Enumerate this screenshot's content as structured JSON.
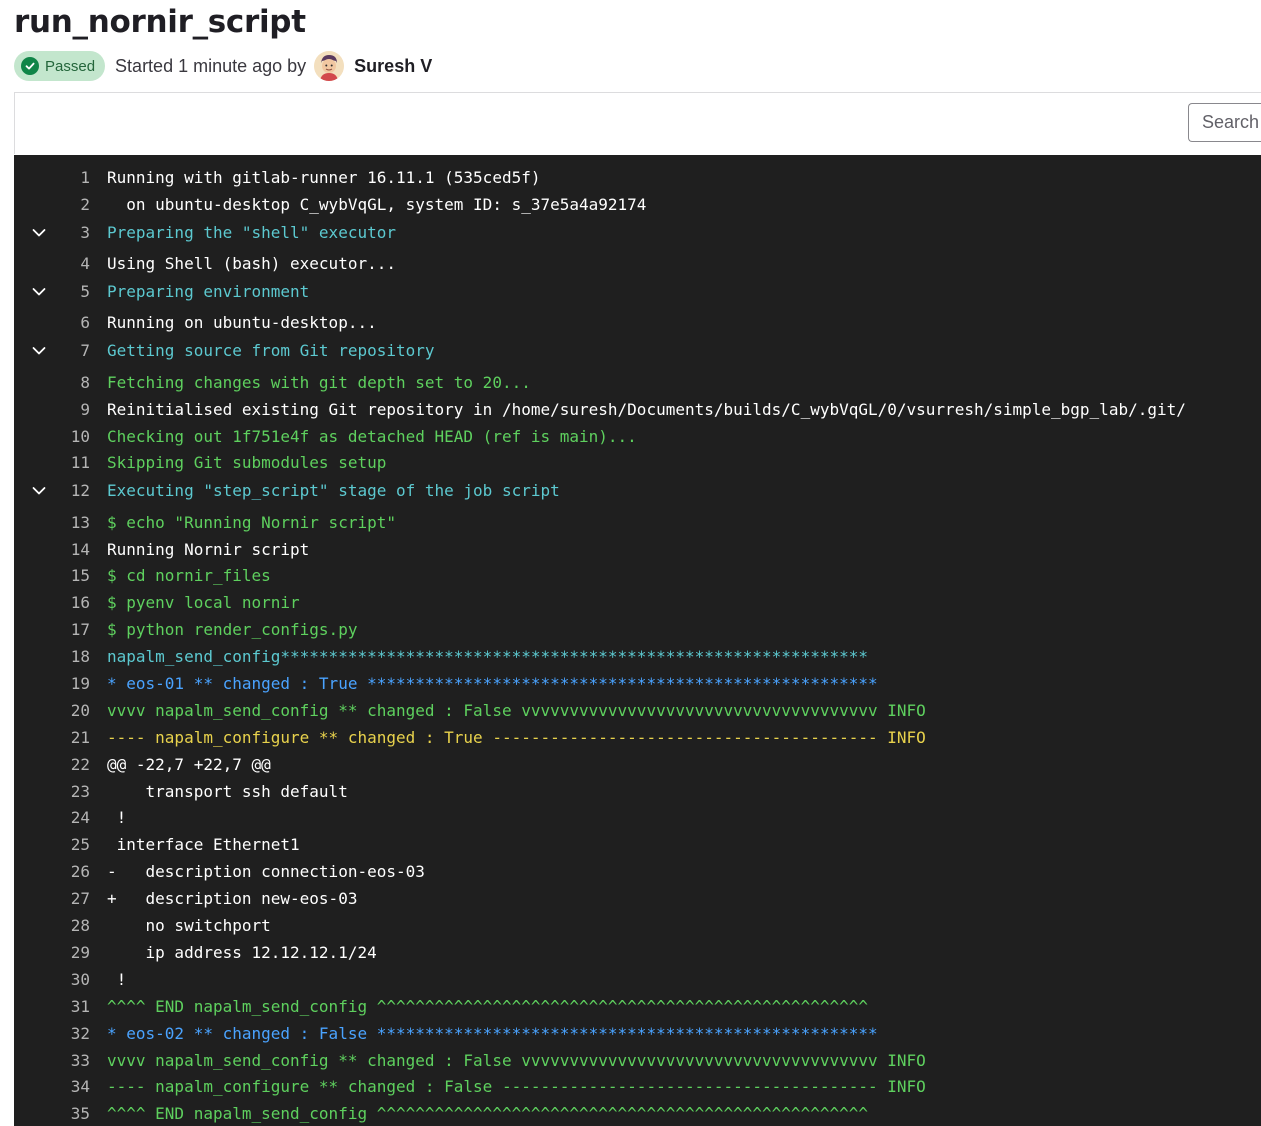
{
  "job": {
    "title": "run_nornir_script",
    "status": "Passed",
    "started": "Started 1 minute ago by",
    "user": "Suresh V"
  },
  "search": {
    "placeholder": "Search"
  },
  "colors": {
    "passed_bg": "#c3e6cd",
    "passed_text": "#24663b",
    "log_bg": "#1f1f1f"
  },
  "log": [
    {
      "num": "1",
      "text": "Running with gitlab-runner 16.11.1 (535ced5f)",
      "color": "white"
    },
    {
      "num": "2",
      "text": "  on ubuntu-desktop C_wybVqGL, system ID: s_37e5a4a92174",
      "color": "white"
    },
    {
      "num": "3",
      "text": "Preparing the \"shell\" executor",
      "color": "cyan",
      "section": true
    },
    {
      "num": "4",
      "text": "Using Shell (bash) executor...",
      "color": "white"
    },
    {
      "num": "5",
      "text": "Preparing environment",
      "color": "cyan",
      "section": true
    },
    {
      "num": "6",
      "text": "Running on ubuntu-desktop...",
      "color": "white"
    },
    {
      "num": "7",
      "text": "Getting source from Git repository",
      "color": "cyan",
      "section": true
    },
    {
      "num": "8",
      "text": "Fetching changes with git depth set to 20...",
      "color": "green"
    },
    {
      "num": "9",
      "text": "Reinitialised existing Git repository in /home/suresh/Documents/builds/C_wybVqGL/0/vsurresh/simple_bgp_lab/.git/",
      "color": "white"
    },
    {
      "num": "10",
      "text": "Checking out 1f751e4f as detached HEAD (ref is main)...",
      "color": "green"
    },
    {
      "num": "11",
      "text": "Skipping Git submodules setup",
      "color": "green"
    },
    {
      "num": "12",
      "text": "Executing \"step_script\" stage of the job script",
      "color": "cyan",
      "section": true
    },
    {
      "num": "13",
      "text": "$ echo \"Running Nornir script\"",
      "color": "green"
    },
    {
      "num": "14",
      "text": "Running Nornir script",
      "color": "white"
    },
    {
      "num": "15",
      "text": "$ cd nornir_files",
      "color": "green"
    },
    {
      "num": "16",
      "text": "$ pyenv local nornir",
      "color": "green"
    },
    {
      "num": "17",
      "text": "$ python render_configs.py",
      "color": "green"
    },
    {
      "num": "18",
      "text": "napalm_send_config*************************************************************",
      "color": "cyan"
    },
    {
      "num": "19",
      "text": "* eos-01 ** changed : True *****************************************************",
      "color": "blue"
    },
    {
      "num": "20",
      "text": "vvvv napalm_send_config ** changed : False vvvvvvvvvvvvvvvvvvvvvvvvvvvvvvvvvvvvv INFO",
      "color": "green"
    },
    {
      "num": "21",
      "text": "---- napalm_configure ** changed : True ---------------------------------------- INFO",
      "color": "yellow"
    },
    {
      "num": "22",
      "text": "@@ -22,7 +22,7 @@",
      "color": "white"
    },
    {
      "num": "23",
      "text": "    transport ssh default",
      "color": "white"
    },
    {
      "num": "24",
      "text": " !",
      "color": "white"
    },
    {
      "num": "25",
      "text": " interface Ethernet1",
      "color": "white"
    },
    {
      "num": "26",
      "text": "-   description connection-eos-03",
      "color": "white"
    },
    {
      "num": "27",
      "text": "+   description new-eos-03",
      "color": "white"
    },
    {
      "num": "28",
      "text": "    no switchport",
      "color": "white"
    },
    {
      "num": "29",
      "text": "    ip address 12.12.12.1/24",
      "color": "white"
    },
    {
      "num": "30",
      "text": " !",
      "color": "white"
    },
    {
      "num": "31",
      "text": "^^^^ END napalm_send_config ^^^^^^^^^^^^^^^^^^^^^^^^^^^^^^^^^^^^^^^^^^^^^^^^^^^",
      "color": "green"
    },
    {
      "num": "32",
      "text": "* eos-02 ** changed : False ****************************************************",
      "color": "blue"
    },
    {
      "num": "33",
      "text": "vvvv napalm_send_config ** changed : False vvvvvvvvvvvvvvvvvvvvvvvvvvvvvvvvvvvvv INFO",
      "color": "green"
    },
    {
      "num": "34",
      "text": "---- napalm_configure ** changed : False --------------------------------------- INFO",
      "color": "green"
    },
    {
      "num": "35",
      "text": "^^^^ END napalm_send_config ^^^^^^^^^^^^^^^^^^^^^^^^^^^^^^^^^^^^^^^^^^^^^^^^^^^",
      "color": "green"
    }
  ]
}
